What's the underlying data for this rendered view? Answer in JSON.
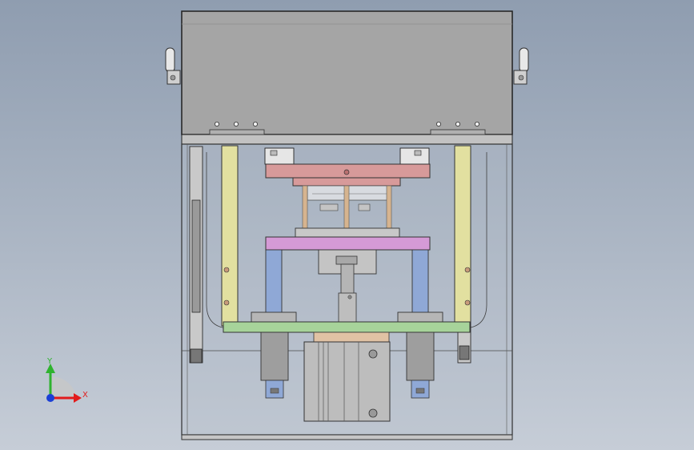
{
  "viewport": {
    "background_top": "#8f9db0",
    "background_bottom": "#c6cdd7"
  },
  "model": {
    "parts": [
      {
        "name": "top-cover",
        "color": "#a5a5a5"
      },
      {
        "name": "lower-frame",
        "color": "#b4bcc8"
      },
      {
        "name": "guide-rail-left",
        "color": "#e2e0a0"
      },
      {
        "name": "guide-rail-right",
        "color": "#e2e0a0"
      },
      {
        "name": "upper-die-plate",
        "color": "#d79a9a"
      },
      {
        "name": "middle-plate",
        "color": "#d59ad6"
      },
      {
        "name": "base-plate",
        "color": "#a7d39a"
      },
      {
        "name": "guide-post-left",
        "color": "#8fa8d6"
      },
      {
        "name": "guide-post-right",
        "color": "#8fa8d6"
      },
      {
        "name": "cylinder",
        "color": "#bdbdbd"
      },
      {
        "name": "guide-pins",
        "color": "#d6b48f"
      },
      {
        "name": "side-clamps",
        "color": "#e6e6e6"
      }
    ]
  },
  "triad": {
    "x_label": "X",
    "y_label": "Y",
    "x_color": "#e21b1b",
    "y_color": "#2fb32f",
    "z_color": "#1b3fd6"
  }
}
